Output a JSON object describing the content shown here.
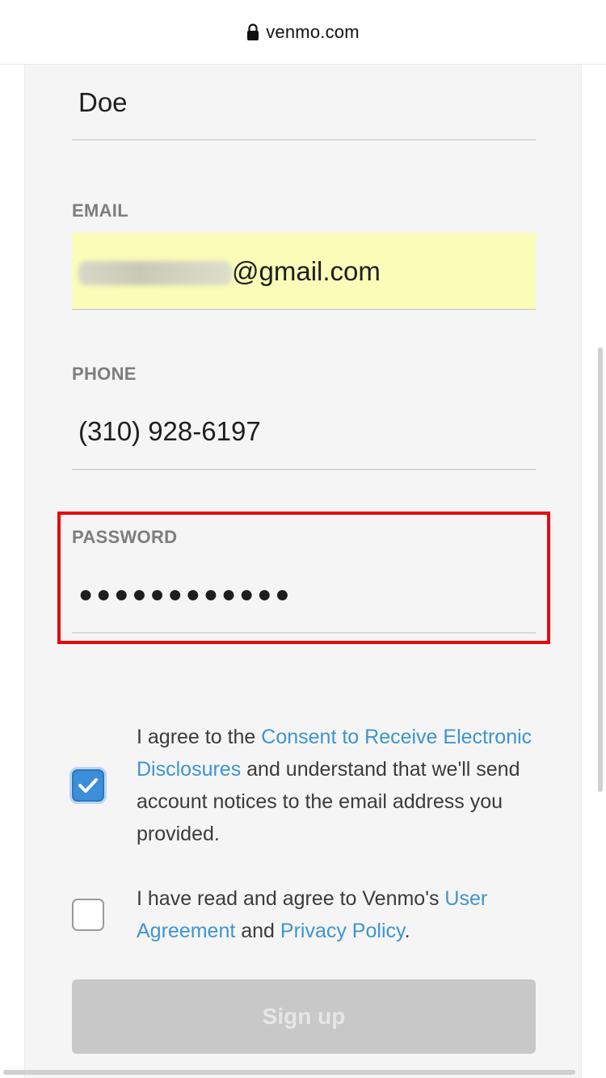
{
  "browser": {
    "domain": "venmo.com",
    "lock_icon": "lock-icon"
  },
  "form": {
    "last_name": {
      "value": "Doe"
    },
    "email": {
      "label": "EMAIL",
      "visible_suffix": "@gmail.com",
      "autofilled": true
    },
    "phone": {
      "label": "PHONE",
      "value": "(310) 928-6197"
    },
    "password": {
      "label": "PASSWORD",
      "masked_value": "●●●●●●●●●●●●"
    }
  },
  "agreements": {
    "consent": {
      "checked": true,
      "text_before": "I agree to the ",
      "link": "Consent to Receive Electronic Disclosures",
      "text_after": " and understand that we'll send account notices to the email address you provided."
    },
    "terms": {
      "checked": false,
      "text_before": "I have read and agree to Venmo's ",
      "link_1": "User Agreement",
      "text_middle": " and ",
      "link_2": "Privacy Policy",
      "text_after": "."
    }
  },
  "signup_button": {
    "label": "Sign up"
  },
  "colors": {
    "link": "#3d95ce",
    "checkbox_checked": "#3d8ed8",
    "highlight_border": "#e8070d",
    "autofill_bg": "#fafcb8",
    "button_disabled": "#c8c8c8"
  }
}
